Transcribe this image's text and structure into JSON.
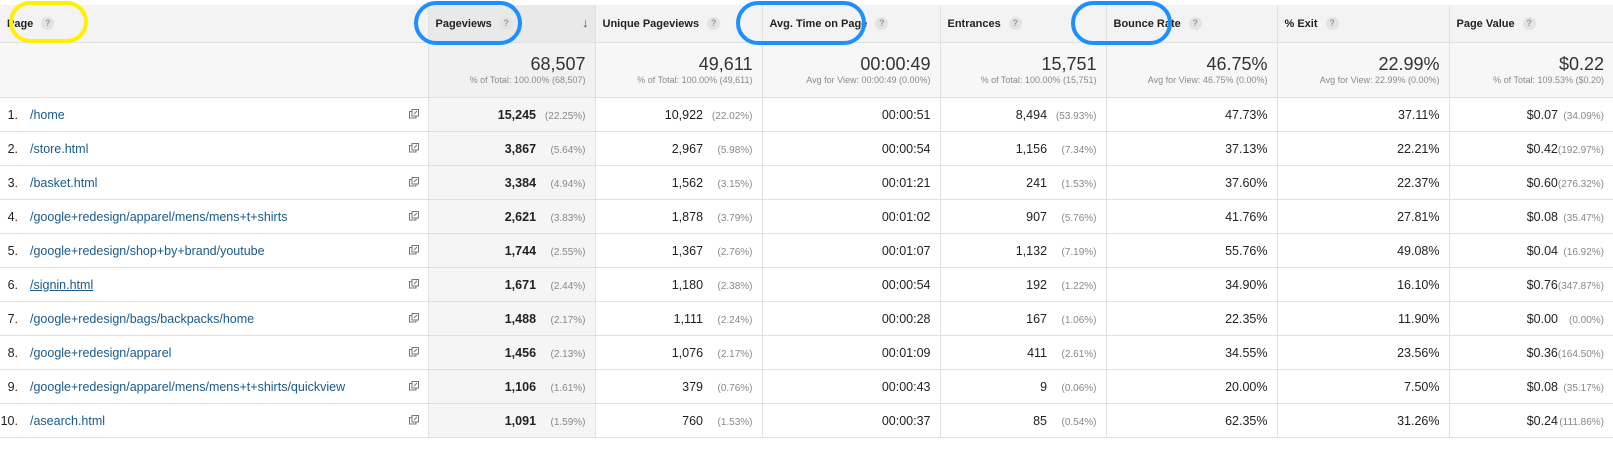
{
  "columns": [
    {
      "key": "page",
      "label": "Page",
      "help": "?"
    },
    {
      "key": "pageviews",
      "label": "Pageviews",
      "help": "?",
      "sort_icon": "arrow-down-icon"
    },
    {
      "key": "unique_pageviews",
      "label": "Unique Pageviews",
      "help": "?"
    },
    {
      "key": "avg_time",
      "label": "Avg. Time on Page",
      "help": "?"
    },
    {
      "key": "entrances",
      "label": "Entrances",
      "help": "?"
    },
    {
      "key": "bounce_rate",
      "label": "Bounce Rate",
      "help": "?"
    },
    {
      "key": "exit",
      "label": "% Exit",
      "help": "?"
    },
    {
      "key": "page_value",
      "label": "Page Value",
      "help": "?"
    }
  ],
  "totals": {
    "pageviews": {
      "value": "68,507",
      "sub": "% of Total: 100.00% (68,507)"
    },
    "unique_pageviews": {
      "value": "49,611",
      "sub": "% of Total: 100.00% (49,611)"
    },
    "avg_time": {
      "value": "00:00:49",
      "sub": "Avg for View: 00:00:49 (0.00%)"
    },
    "entrances": {
      "value": "15,751",
      "sub": "% of Total: 100.00% (15,751)"
    },
    "bounce_rate": {
      "value": "46.75%",
      "sub": "Avg for View: 46.75% (0.00%)"
    },
    "exit": {
      "value": "22.99%",
      "sub": "Avg for View: 22.99% (0.00%)"
    },
    "page_value": {
      "value": "$0.22",
      "sub": "% of Total: 109.53% ($0.20)"
    }
  },
  "rows": [
    {
      "idx": "1.",
      "page": "/home",
      "pv": "15,245",
      "pv_pct": "(22.25%)",
      "upv": "10,922",
      "upv_pct": "(22.02%)",
      "atp": "00:00:51",
      "ent": "8,494",
      "ent_pct": "(53.93%)",
      "br": "47.73%",
      "ex": "37.11%",
      "val": "$0.07",
      "val_pct": "(34.09%)"
    },
    {
      "idx": "2.",
      "page": "/store.html",
      "pv": "3,867",
      "pv_pct": "(5.64%)",
      "upv": "2,967",
      "upv_pct": "(5.98%)",
      "atp": "00:00:54",
      "ent": "1,156",
      "ent_pct": "(7.34%)",
      "br": "37.13%",
      "ex": "22.21%",
      "val": "$0.42",
      "val_pct": "(192.97%)"
    },
    {
      "idx": "3.",
      "page": "/basket.html",
      "pv": "3,384",
      "pv_pct": "(4.94%)",
      "upv": "1,562",
      "upv_pct": "(3.15%)",
      "atp": "00:01:21",
      "ent": "241",
      "ent_pct": "(1.53%)",
      "br": "37.60%",
      "ex": "22.37%",
      "val": "$0.60",
      "val_pct": "(276.32%)"
    },
    {
      "idx": "4.",
      "page": "/google+redesign/apparel/mens/mens+t+shirts",
      "pv": "2,621",
      "pv_pct": "(3.83%)",
      "upv": "1,878",
      "upv_pct": "(3.79%)",
      "atp": "00:01:02",
      "ent": "907",
      "ent_pct": "(5.76%)",
      "br": "41.76%",
      "ex": "27.81%",
      "val": "$0.08",
      "val_pct": "(35.47%)"
    },
    {
      "idx": "5.",
      "page": "/google+redesign/shop+by+brand/youtube",
      "pv": "1,744",
      "pv_pct": "(2.55%)",
      "upv": "1,367",
      "upv_pct": "(2.76%)",
      "atp": "00:01:07",
      "ent": "1,132",
      "ent_pct": "(7.19%)",
      "br": "55.76%",
      "ex": "49.08%",
      "val": "$0.04",
      "val_pct": "(16.92%)"
    },
    {
      "idx": "6.",
      "page": "/signin.html",
      "pv": "1,671",
      "pv_pct": "(2.44%)",
      "upv": "1,180",
      "upv_pct": "(2.38%)",
      "atp": "00:00:54",
      "ent": "192",
      "ent_pct": "(1.22%)",
      "br": "34.90%",
      "ex": "16.10%",
      "val": "$0.76",
      "val_pct": "(347.87%)"
    },
    {
      "idx": "7.",
      "page": "/google+redesign/bags/backpacks/home",
      "pv": "1,488",
      "pv_pct": "(2.17%)",
      "upv": "1,111",
      "upv_pct": "(2.24%)",
      "atp": "00:00:28",
      "ent": "167",
      "ent_pct": "(1.06%)",
      "br": "22.35%",
      "ex": "11.90%",
      "val": "$0.00",
      "val_pct": "(0.00%)"
    },
    {
      "idx": "8.",
      "page": "/google+redesign/apparel",
      "pv": "1,456",
      "pv_pct": "(2.13%)",
      "upv": "1,076",
      "upv_pct": "(2.17%)",
      "atp": "00:01:09",
      "ent": "411",
      "ent_pct": "(2.61%)",
      "br": "34.55%",
      "ex": "23.56%",
      "val": "$0.36",
      "val_pct": "(164.50%)"
    },
    {
      "idx": "9.",
      "page": "/google+redesign/apparel/mens/mens+t+shirts/quickview",
      "pv": "1,106",
      "pv_pct": "(1.61%)",
      "upv": "379",
      "upv_pct": "(0.76%)",
      "atp": "00:00:43",
      "ent": "9",
      "ent_pct": "(0.06%)",
      "br": "20.00%",
      "ex": "7.50%",
      "val": "$0.08",
      "val_pct": "(35.17%)"
    },
    {
      "idx": "10.",
      "page": "/asearch.html",
      "pv": "1,091",
      "pv_pct": "(1.59%)",
      "upv": "760",
      "upv_pct": "(1.53%)",
      "atp": "00:00:37",
      "ent": "85",
      "ent_pct": "(0.54%)",
      "br": "62.35%",
      "ex": "31.26%",
      "val": "$0.24",
      "val_pct": "(111.86%)"
    }
  ],
  "highlight_colors": {
    "yellow": "#ffef00",
    "blue": "#1e8fff"
  }
}
